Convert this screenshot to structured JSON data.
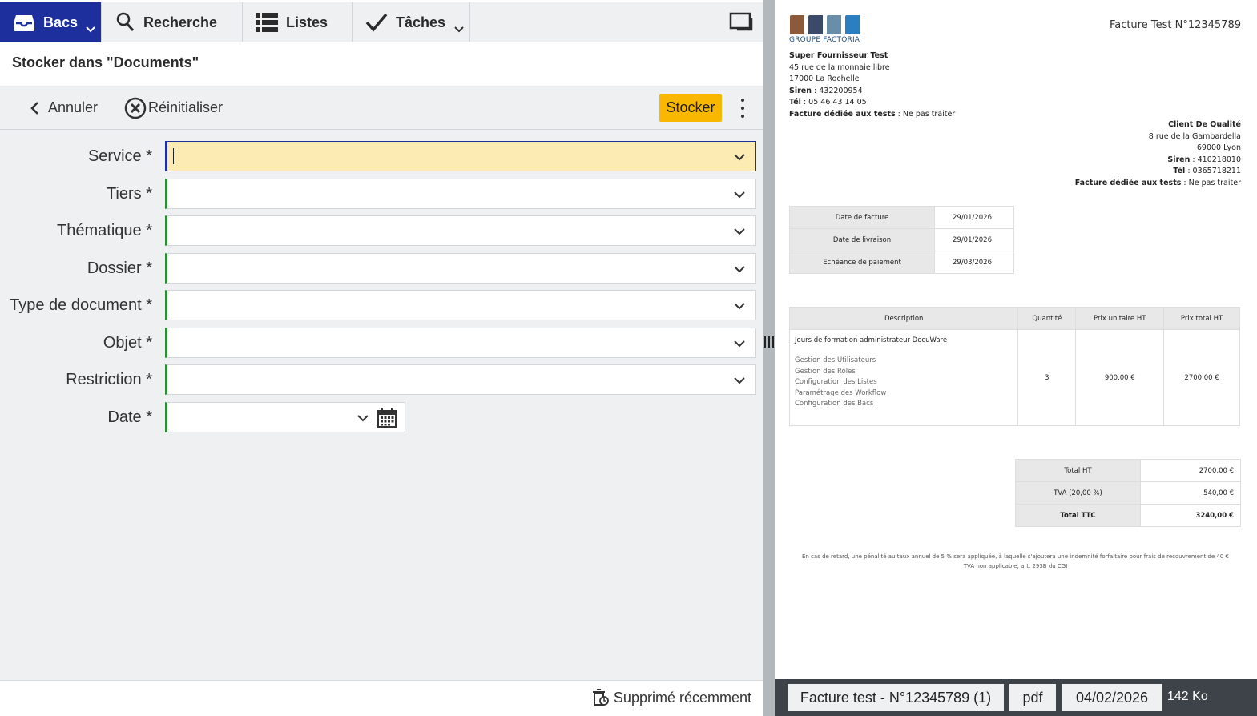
{
  "nav": {
    "tabs": [
      {
        "label": "Bacs",
        "icon": "inbox-icon"
      },
      {
        "label": "Recherche",
        "icon": "search-icon"
      },
      {
        "label": "Listes",
        "icon": "list-icon"
      },
      {
        "label": "Tâches",
        "icon": "checkmark-icon"
      }
    ],
    "accent": "#1c2f9c"
  },
  "page": {
    "title": "Stocker dans \"Documents\""
  },
  "toolbar": {
    "cancel_label": "Annuler",
    "reset_label": "Réinitialiser",
    "store_label": "Stocker",
    "store_color": "#f9b700"
  },
  "form": {
    "fields": [
      {
        "label": "Service *",
        "value": ""
      },
      {
        "label": "Tiers *",
        "value": ""
      },
      {
        "label": "Thématique *",
        "value": ""
      },
      {
        "label": "Dossier *",
        "value": ""
      },
      {
        "label": "Type de document *",
        "value": ""
      },
      {
        "label": "Objet *",
        "value": ""
      },
      {
        "label": "Restriction *",
        "value": ""
      },
      {
        "label": "Date *",
        "value": ""
      }
    ],
    "required_color": "#2e8b36"
  },
  "footer": {
    "deleted_label": "Supprimé récemment"
  },
  "document": {
    "logo_text": "GROUPE FACTORIA",
    "title": "Facture Test N°12345789",
    "supplier": {
      "name": "Super Fournisseur Test",
      "address1": "45 rue de la monnaie libre",
      "address2": "17000 La Rochelle",
      "siren_label": "Siren",
      "siren": " : 432200954",
      "tel_label": "Tél",
      "tel": " : 05 46 43 14 05",
      "note_label": "Facture dédiée aux tests",
      "note": " : Ne pas traiter"
    },
    "client": {
      "name": "Client De Qualité",
      "address1": "8 rue de la Gambardella",
      "address2": "69000 Lyon",
      "siren_label": "Siren",
      "siren": " : 410218010",
      "tel_label": "Tél",
      "tel": " : 0365718211",
      "note_label": "Facture dédiée aux tests",
      "note": " : Ne pas traiter"
    },
    "dates": [
      {
        "label": "Date de facture",
        "value": "29/01/2026"
      },
      {
        "label": "Date de livraison",
        "value": "29/01/2026"
      },
      {
        "label": "Echéance de paiement",
        "value": "29/03/2026"
      }
    ],
    "items_headers": [
      "Description",
      "Quantité",
      "Prix unitaire HT",
      "Prix total HT"
    ],
    "item": {
      "title": "Jours de formation administrateur DocuWare",
      "lines": [
        "Gestion des Utilisateurs",
        "Gestion des Rôles",
        "Configuration des Listes",
        "Paramétrage des Workflow",
        "Configuration des Bacs"
      ],
      "qty": "3",
      "unit": "900,00 €",
      "total": "2700,00 €"
    },
    "totals": [
      {
        "label": "Total HT",
        "value": "2700,00 €"
      },
      {
        "label": "TVA (20,00 %)",
        "value": "540,00 €"
      },
      {
        "label": "Total TTC",
        "value": "3240,00 €"
      }
    ],
    "note_line1": "En cas de retard, une pénalité au taux annuel de 5 % sera appliquée, à laquelle s'ajoutera une indemnité forfaitaire pour frais de recouvrement de 40 €",
    "note_line2": "TVA non applicable, art. 293B du CGI"
  },
  "viewer_footer": {
    "filename": "Facture test - N°12345789 (1)",
    "filetype": "pdf",
    "date": "04/02/2026",
    "size": "142 Ko"
  }
}
